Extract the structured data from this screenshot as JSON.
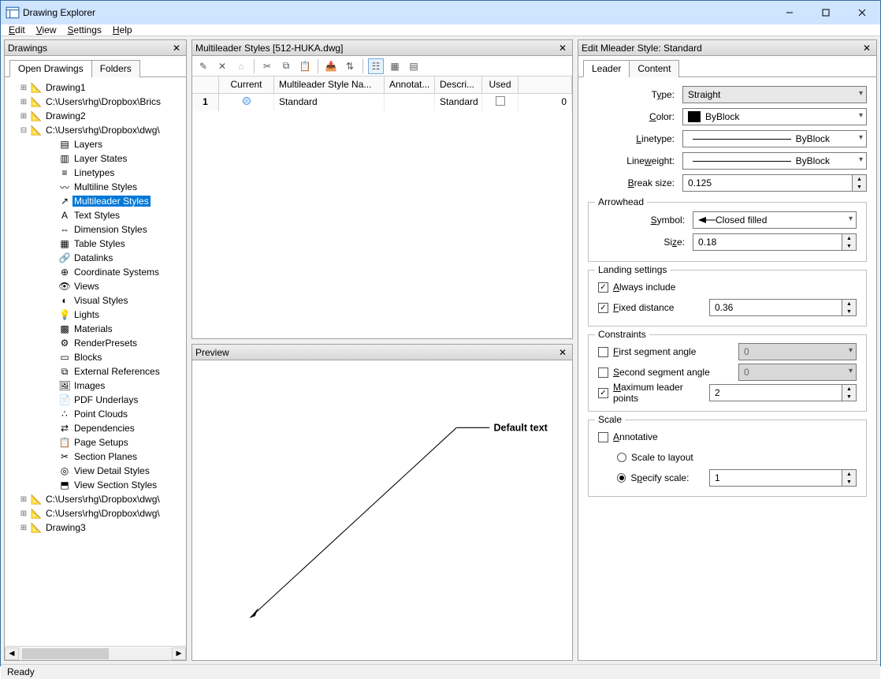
{
  "window": {
    "title": "Drawing Explorer"
  },
  "menu": {
    "edit": "Edit",
    "view": "View",
    "settings": "Settings",
    "help": "Help"
  },
  "left_panel": {
    "title": "Drawings",
    "tabs": {
      "open": "Open Drawings",
      "folders": "Folders"
    },
    "tree": {
      "n0": "Drawing1",
      "n1": "C:\\Users\\rhg\\Dropbox\\Brics",
      "n2": "Drawing2",
      "n3": "C:\\Users\\rhg\\Dropbox\\dwg\\",
      "sub": {
        "layers": "Layers",
        "layerstates": "Layer States",
        "linetypes": "Linetypes",
        "mlstyles": "Multiline Styles",
        "mleader": "Multileader Styles",
        "textstyles": "Text Styles",
        "dimstyles": "Dimension Styles",
        "tablestyles": "Table Styles",
        "datalinks": "Datalinks",
        "coord": "Coordinate Systems",
        "views": "Views",
        "visual": "Visual Styles",
        "lights": "Lights",
        "materials": "Materials",
        "render": "RenderPresets",
        "blocks": "Blocks",
        "xrefs": "External References",
        "images": "Images",
        "pdf": "PDF Underlays",
        "pcloud": "Point Clouds",
        "deps": "Dependencies",
        "pagesetup": "Page Setups",
        "section": "Section Planes",
        "viewdetail": "View Detail Styles",
        "viewsection": "View Section Styles"
      },
      "n4": "C:\\Users\\rhg\\Dropbox\\dwg\\",
      "n5": "C:\\Users\\rhg\\Dropbox\\dwg\\",
      "n6": "Drawing3"
    }
  },
  "mid_panel": {
    "title": "Multileader Styles [512-HUKA.dwg]",
    "cols": {
      "rownum": "",
      "current": "Current",
      "name": "Multileader Style Na...",
      "annot": "Annotat...",
      "descr": "Descri...",
      "used": "Used",
      "count": ""
    },
    "row1": {
      "num": "1",
      "name": "Standard",
      "descr": "Standard",
      "count": "0"
    }
  },
  "preview": {
    "title": "Preview",
    "default_text": "Default text"
  },
  "right_panel": {
    "title": "Edit Mleader Style: Standard",
    "tabs": {
      "leader": "Leader",
      "content": "Content"
    },
    "labels": {
      "type": "Type:",
      "color": "Color:",
      "linetype": "Linetype:",
      "lineweight": "Lineweight:",
      "breaksize": "Break size:",
      "arrowhead": "Arrowhead",
      "symbol": "Symbol:",
      "size": "Size:",
      "landing": "Landing settings",
      "always": "Always include",
      "fixed": "Fixed distance",
      "constraints": "Constraints",
      "firstseg": "First segment angle",
      "secondseg": "Second segment angle",
      "maxpts": "Maximum leader points",
      "scale": "Scale",
      "annotative": "Annotative",
      "scaletolayout": "Scale to layout",
      "specifyscale": "Specify scale:"
    },
    "values": {
      "type": "Straight",
      "color": "ByBlock",
      "linetype": "ByBlock",
      "lineweight": "ByBlock",
      "breaksize": "0.125",
      "symbol": "Closed filled",
      "arrowsize": "0.18",
      "fixeddist": "0.36",
      "firstseg": "0",
      "secondseg": "0",
      "maxpts": "2",
      "specifyscale": "1"
    }
  },
  "status": {
    "text": "Ready"
  }
}
